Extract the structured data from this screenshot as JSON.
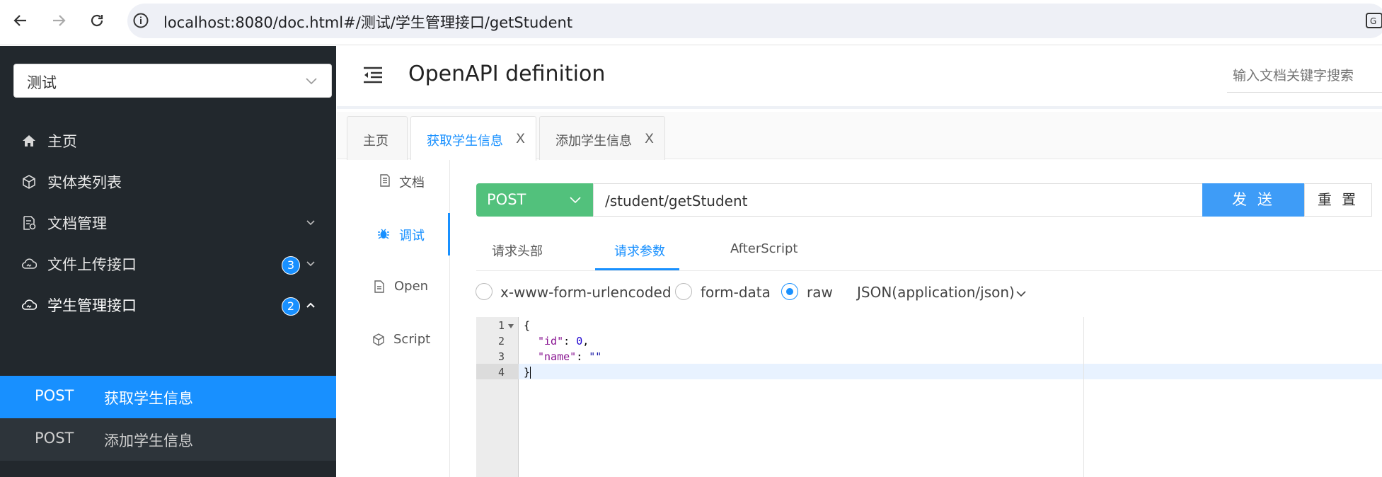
{
  "browser": {
    "url": "localhost:8080/doc.html#/测试/学生管理接口/getStudent"
  },
  "sidebar": {
    "project": "测试",
    "menu": [
      {
        "label": "主页"
      },
      {
        "label": "实体类列表"
      },
      {
        "label": "文档管理"
      },
      {
        "label": "文件上传接口",
        "badge": "3"
      },
      {
        "label": "学生管理接口",
        "badge": "2"
      }
    ],
    "subitems": [
      {
        "method": "POST",
        "label": "获取学生信息"
      },
      {
        "method": "POST",
        "label": "添加学生信息"
      }
    ]
  },
  "header": {
    "title": "OpenAPI definition",
    "search_placeholder": "输入文档关键字搜索"
  },
  "tabs": [
    {
      "label": "主页"
    },
    {
      "label": "获取学生信息",
      "close": "X"
    },
    {
      "label": "添加学生信息",
      "close": "X"
    }
  ],
  "subnav": [
    {
      "label": "文档"
    },
    {
      "label": "调试"
    },
    {
      "label": "Open"
    },
    {
      "label": "Script"
    }
  ],
  "request": {
    "method": "POST",
    "path": "/student/getStudent",
    "send_label": "发 送",
    "reset_label": "重 置"
  },
  "inner_tabs": [
    {
      "label": "请求头部"
    },
    {
      "label": "请求参数"
    },
    {
      "label": "AfterScript"
    }
  ],
  "body_types": [
    {
      "label": "x-www-form-urlencoded"
    },
    {
      "label": "form-data"
    },
    {
      "label": "raw"
    }
  ],
  "content_type": "JSON(application/json)",
  "editor": {
    "line_numbers": [
      "1",
      "2",
      "3",
      "4"
    ],
    "lines": {
      "open": "{",
      "id_key": "\"id\"",
      "id_colon": ": ",
      "id_value": "0",
      "id_comma": ",",
      "name_key": "\"name\"",
      "name_colon": ": ",
      "name_value": "\"\"",
      "close": "}"
    }
  },
  "colors": {
    "accent": "#1890ff",
    "post": "#52c17c",
    "sidebar_bg": "#22282d",
    "send": "#3e9cf7"
  }
}
